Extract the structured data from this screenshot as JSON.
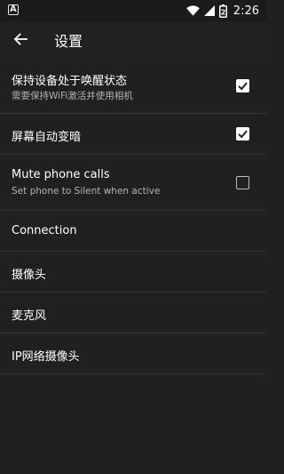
{
  "statusbar": {
    "notification_glyph": "A",
    "time": "2:26",
    "battery_level": "2"
  },
  "appbar": {
    "title": "设置",
    "back_icon": "arrow-left-icon"
  },
  "items": [
    {
      "label": "保持设备处于唤醒状态",
      "sub": "需要保持WiFi激活并使用相机",
      "checked": true
    },
    {
      "label": "屏幕自动变暗",
      "checked": true
    },
    {
      "label": "Mute phone calls",
      "sub": "Set phone to Silent when active",
      "checked": false
    },
    {
      "label": "Connection"
    },
    {
      "label": "摄像头"
    },
    {
      "label": "麦克风"
    },
    {
      "label": "IP网络摄像头"
    }
  ]
}
